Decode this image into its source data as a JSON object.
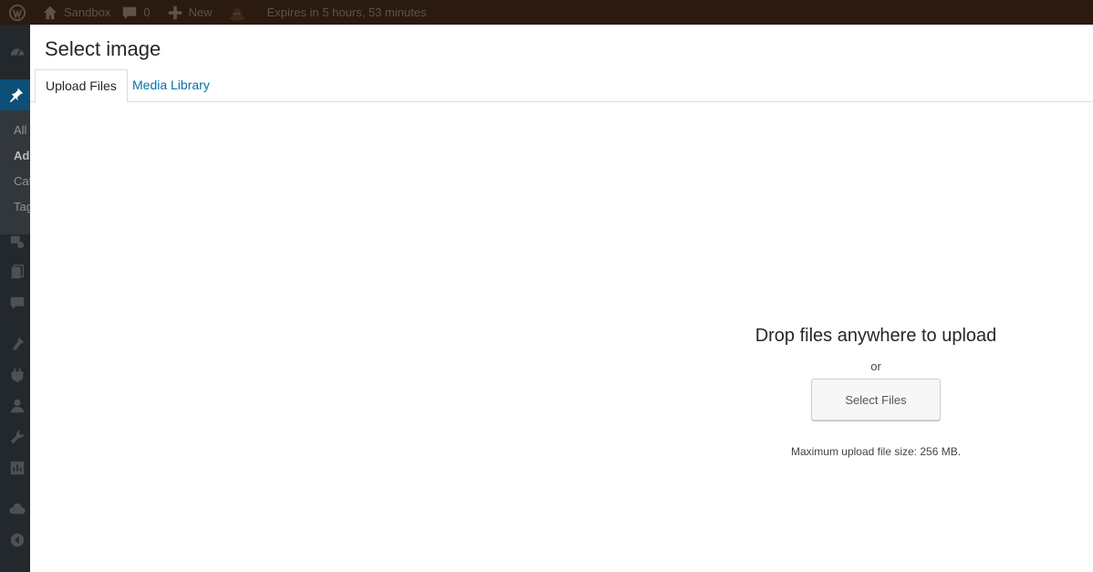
{
  "adminbar": {
    "site_name": "Sandbox",
    "comments_count": "0",
    "new_label": "New",
    "expires_text": "Expires in 5 hours, 53 minutes"
  },
  "adminmenu": {
    "submenu": [
      "All",
      "Ad",
      "Cat",
      "Tag"
    ]
  },
  "modal": {
    "title": "Select image",
    "tabs": [
      {
        "label": "Upload Files",
        "active": true
      },
      {
        "label": "Media Library",
        "active": false
      }
    ],
    "upload": {
      "drop_title": "Drop files anywhere to upload",
      "or_text": "or",
      "select_button": "Select Files",
      "max_size": "Maximum upload file size: 256 MB."
    }
  },
  "colors": {
    "adminbar_bg": "#2a1a0f",
    "menu_bg": "#23282d",
    "active_menu": "#0e4f77",
    "link": "#0073aa"
  },
  "icons": {
    "adminbar": [
      "wordpress-logo-icon",
      "home-icon",
      "comment-icon",
      "plus-icon",
      "poop-emoji-icon"
    ],
    "menu": [
      "dashboard-icon",
      "pin-icon",
      "media-icon",
      "pages-icon",
      "comments-icon",
      "appearance-icon",
      "plugins-icon",
      "users-icon",
      "tools-icon",
      "settings-icon",
      "cloud-icon",
      "collapse-icon"
    ]
  }
}
